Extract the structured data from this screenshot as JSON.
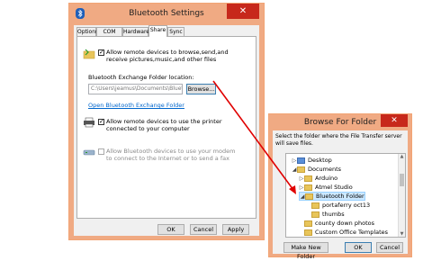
{
  "bt_window": {
    "title": "Bluetooth Settings",
    "close_glyph": "✕",
    "tabs": [
      "Options",
      "COM Ports",
      "Hardware",
      "Share",
      "Sync"
    ],
    "active_tab": "Share",
    "share_files_label": "Allow remote devices to browse,send,and receive pictures,music,and other files",
    "exchange_folder_label": "Bluetooth Exchange Folder location:",
    "exchange_folder_value": "C:\\Users\\jeamus\\Documents\\Bluetooth",
    "browse_label": "Browse...",
    "open_folder_link": "Open Bluetooth Exchange Folder",
    "printer_label": "Allow remote devices to use the printer connected to your computer",
    "modem_label": "Allow Bluetooth devices to use your modem to connect to the Internet or to send a fax",
    "ok_label": "OK",
    "cancel_label": "Cancel",
    "apply_label": "Apply"
  },
  "browse_window": {
    "title": "Browse For Folder",
    "close_glyph": "✕",
    "instruction": "Select the folder where the File Transfer server will save files.",
    "tree": [
      {
        "label": "Desktop",
        "expanded": false,
        "indent": 1,
        "icon": "folder-blue-icon"
      },
      {
        "label": "Documents",
        "expanded": true,
        "indent": 1,
        "icon": "folder-icon"
      },
      {
        "label": "Arduino",
        "expanded": false,
        "indent": 2,
        "icon": "folder-icon"
      },
      {
        "label": "Atmel Studio",
        "expanded": false,
        "indent": 2,
        "icon": "folder-icon"
      },
      {
        "label": "Bluetooth Folder",
        "expanded": true,
        "indent": 2,
        "icon": "folder-icon",
        "selected": true
      },
      {
        "label": "portaferry oct13",
        "expanded": null,
        "indent": 3,
        "icon": "folder-icon"
      },
      {
        "label": "thumbs",
        "expanded": null,
        "indent": 3,
        "icon": "folder-icon"
      },
      {
        "label": "county down photos",
        "expanded": null,
        "indent": 2,
        "icon": "folder-icon"
      },
      {
        "label": "Custom Office Templates",
        "expanded": null,
        "indent": 2,
        "icon": "folder-icon"
      }
    ],
    "make_new_folder_label": "Make New Folder",
    "ok_label": "OK",
    "cancel_label": "Cancel"
  },
  "colors": {
    "frame": "#f0aa83",
    "close": "#c7281b",
    "selection": "#cce8ff",
    "arrow": "#e00000"
  }
}
